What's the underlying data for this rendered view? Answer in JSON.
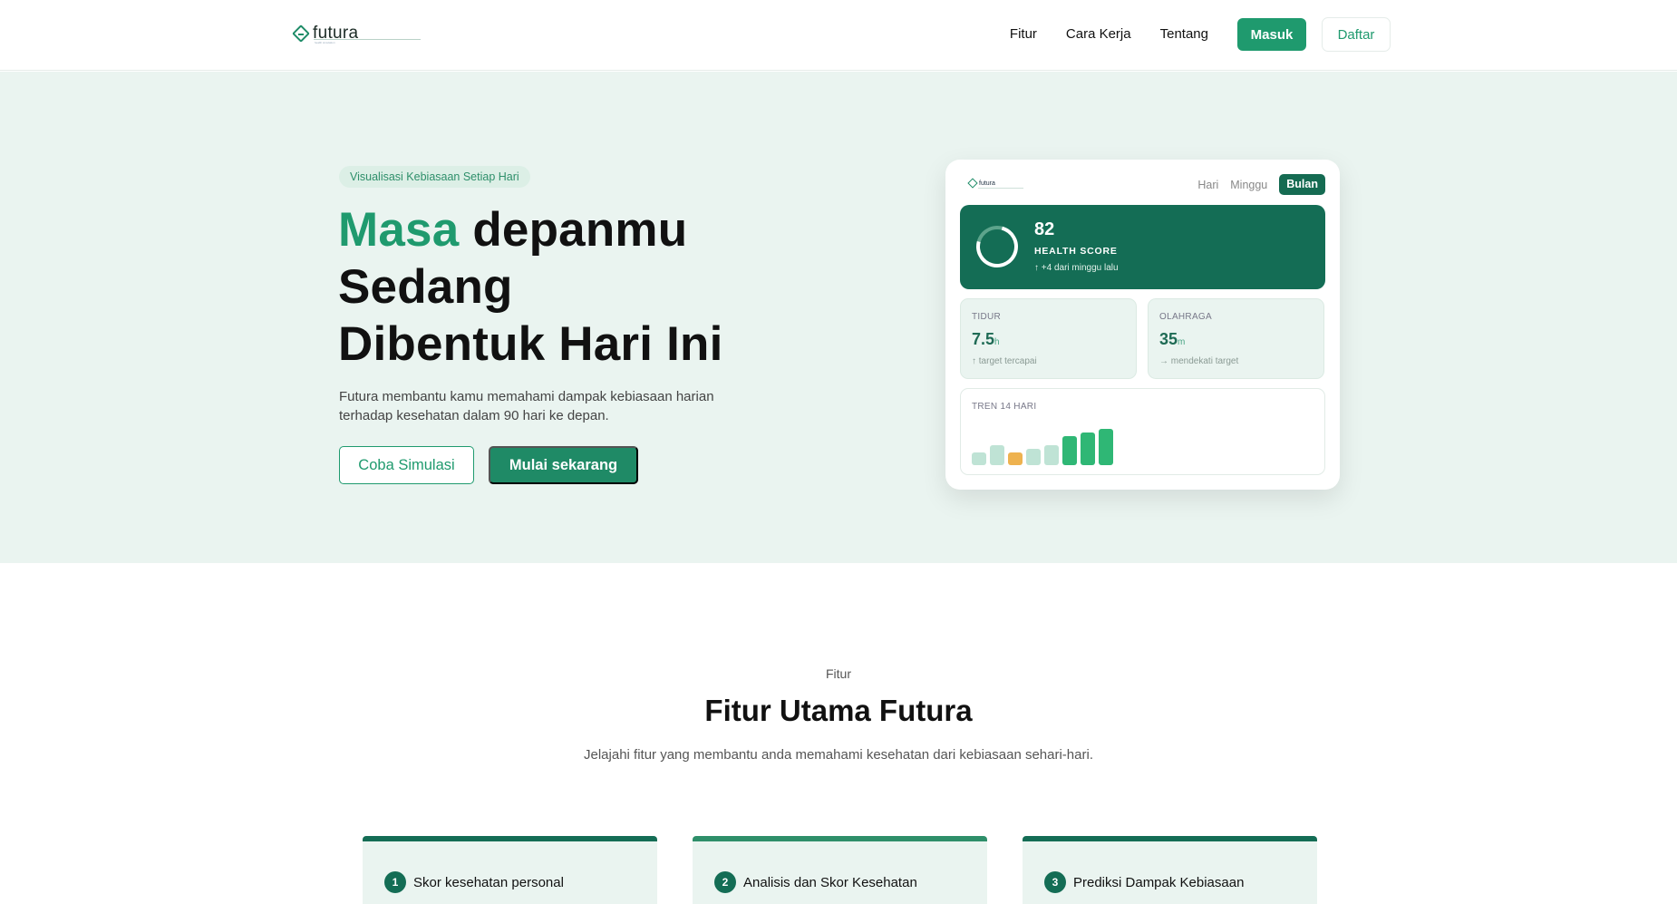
{
  "brand": {
    "name": "futura",
    "tagline": "health simulation"
  },
  "nav": {
    "links": [
      "Fitur",
      "Cara Kerja",
      "Tentang"
    ],
    "login": "Masuk",
    "register": "Daftar"
  },
  "hero": {
    "badge": "Visualisasi Kebiasaan Setiap Hari",
    "title_accent": "Masa",
    "title_l1_rest": " depanmu",
    "title_l2": "Sedang",
    "title_l3": "Dibentuk Hari Ini",
    "description": "Futura membantu kamu memahami dampak kebiasaan harian terhadap kesehatan dalam 90 hari ke depan.",
    "btn_simulation": "Coba Simulasi",
    "btn_start": "Mulai sekarang"
  },
  "dashboard": {
    "logo": "futura",
    "tabs": [
      "Hari",
      "Minggu",
      "Bulan"
    ],
    "active_tab": "Bulan",
    "score": {
      "value": "82",
      "label": "HEALTH SCORE",
      "delta": "↑ +4 dari minggu lalu"
    },
    "sleep": {
      "label": "TIDUR",
      "value": "7.5",
      "unit": "h",
      "note": "↑ target tercapai"
    },
    "exercise": {
      "label": "OLAHRAGA",
      "value": "35",
      "unit": "m",
      "note": "→ mendekati target"
    },
    "trend": {
      "label": "TREN 14 HARI",
      "values": [
        0.35,
        0.55,
        0.35,
        0.45,
        0.55,
        0.8,
        0.9,
        1.0
      ],
      "colors": [
        "#bfe3d5",
        "#bfe3d5",
        "#eeb24f",
        "#bfe3d5",
        "#bfe3d5",
        "#2fb775",
        "#2fb775",
        "#2fb775"
      ]
    }
  },
  "features": {
    "kicker": "Fitur",
    "title": "Fitur Utama Futura",
    "description": "Jelajahi fitur yang membantu anda memahami kesehatan dari kebiasaan sehari-hari.",
    "cards": [
      {
        "num": "1",
        "title": "Skor kesehatan personal"
      },
      {
        "num": "2",
        "title": "Analisis dan Skor Kesehatan"
      },
      {
        "num": "3",
        "title": "Prediksi Dampak Kebiasaan"
      }
    ]
  }
}
